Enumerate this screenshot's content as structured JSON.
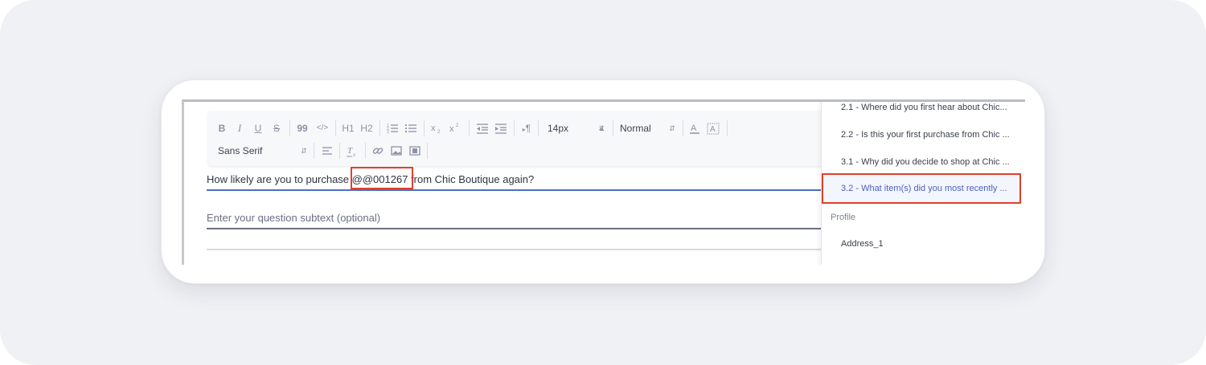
{
  "toolbar": {
    "bold": "B",
    "italic": "I",
    "underline": "U",
    "strike": "S",
    "quote": "99",
    "code": "</>",
    "h1": "H1",
    "h2": "H2",
    "subscript": "X2",
    "superscript": "X2",
    "rtl": "¶",
    "font_size": "14px",
    "heading_style": "Normal",
    "font_family": "Sans Serif"
  },
  "editor": {
    "question_before": "How likely are you to purchase ",
    "mention": "@@001267",
    "question_after": " from Chic Boutique again?",
    "subtext_placeholder": "Enter your question subtext (optional)"
  },
  "dropdown": {
    "items": [
      "2.1 - Where did you first hear about Chic...",
      "2.2 - Is this your first purchase from Chic ...",
      "3.1 - Why did you decide to shop at Chic ...",
      "3.2 - What item(s) did you most recently ..."
    ],
    "group_label": "Profile",
    "profile_items": [
      "Address_1"
    ]
  },
  "colors": {
    "highlight": "#e0402b",
    "active_item": "#4a5fbf",
    "focus_underline": "#4a6fc7"
  }
}
